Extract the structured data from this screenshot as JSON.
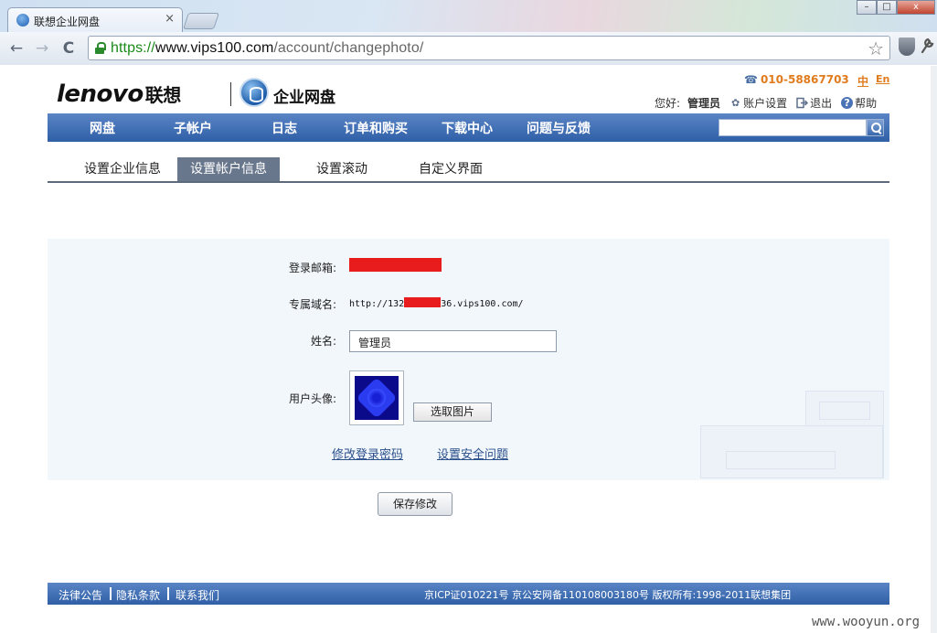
{
  "browser": {
    "tab_title": "联想企业网盘",
    "tab_close": "×",
    "url_scheme": "https://",
    "url_host": "www.vips100.com",
    "url_path": "/account/changephoto/",
    "back": "←",
    "forward": "→",
    "reload": "C",
    "bookmark_star": "☆",
    "minimize": "–",
    "maximize": "□",
    "close": "x"
  },
  "header": {
    "logo_brand": "lenovo",
    "logo_brand_cn": "联想",
    "logo_product": "企业网盘",
    "phone": "010-58867703",
    "lang_cn": "中",
    "lang_en": "En",
    "greeting": "您好:",
    "username": "管理员",
    "account_settings": "账户设置",
    "logout": "退出",
    "help": "帮助"
  },
  "mainnav": {
    "items": [
      "网盘",
      "子帐户",
      "日志",
      "订单和购买",
      "下载中心",
      "问题与反馈"
    ],
    "search_value": ""
  },
  "subtabs": {
    "items": [
      "设置企业信息",
      "设置帐户信息",
      "设置滚动",
      "自定义界面"
    ],
    "active": "设置帐户信息"
  },
  "form": {
    "email_label": "登录邮箱:",
    "domain_label": "专属域名:",
    "domain_prefix": "http://132",
    "domain_suffix": "36.vips100.com/",
    "name_label": "姓名:",
    "name_value": "管理员",
    "avatar_label": "用户头像:",
    "pick_image": "选取图片",
    "change_password": "修改登录密码",
    "security_question": "设置安全问题",
    "save": "保存修改"
  },
  "footer": {
    "legal": "法律公告",
    "privacy": "隐私条款",
    "contact": "联系我们",
    "copyright": "京ICP证010221号 京公安网备110108003180号 版权所有:1998-2011联想集团"
  },
  "watermark": "www.wooyun.org",
  "colors": {
    "nav_blue": "#3b69ad",
    "accent_orange": "#e07b1e",
    "redaction": "#e81c1c",
    "panel_bg": "#f2f7fc"
  },
  "icons": {
    "phone": "☎",
    "account_settings": "gear-icon",
    "logout": "exit-icon",
    "help": "help-icon",
    "search": "search-icon",
    "lock": "lock-icon"
  }
}
